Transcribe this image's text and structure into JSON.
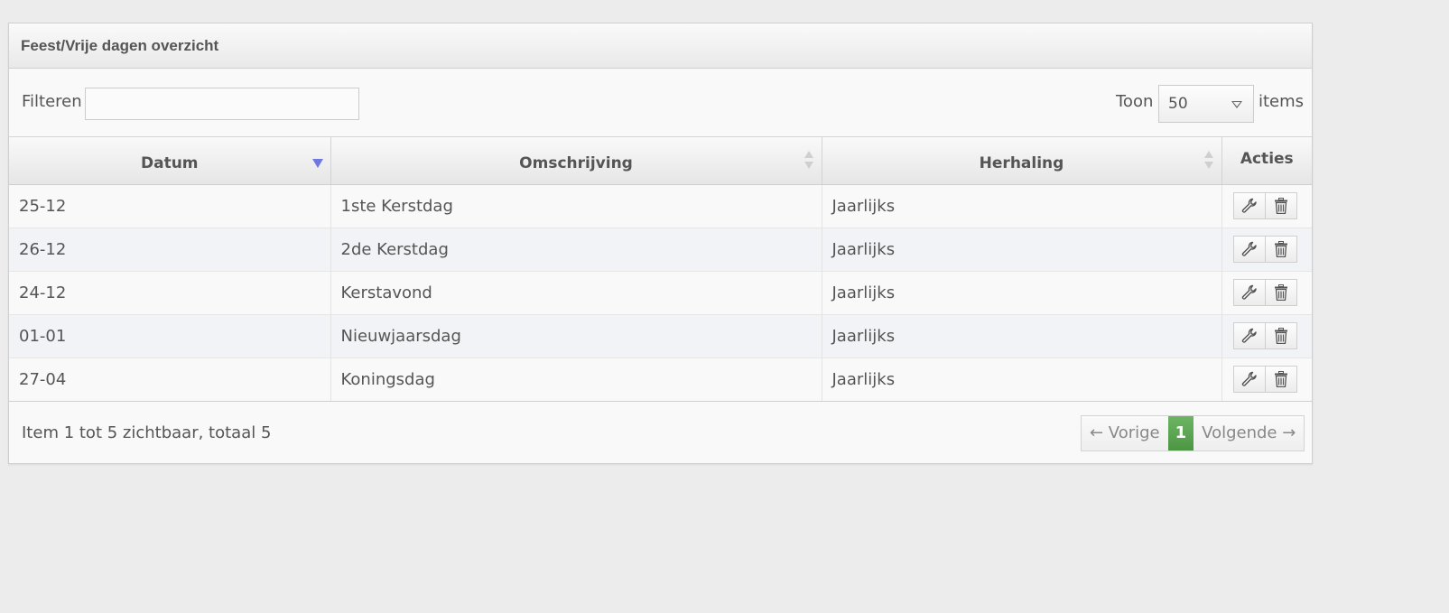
{
  "panel": {
    "title": "Feest/Vrije dagen overzicht"
  },
  "toolbar": {
    "filter_label": "Filteren",
    "filter_value": "",
    "show_label": "Toon",
    "page_size": "50",
    "items_label": "items"
  },
  "table": {
    "columns": [
      "Datum",
      "Omschrijving",
      "Herhaling",
      "Acties"
    ],
    "sort": {
      "column": "Datum",
      "direction": "descending"
    },
    "rows": [
      {
        "datum": "25-12",
        "omschrijving": "1ste Kerstdag",
        "herhaling": "Jaarlijks"
      },
      {
        "datum": "26-12",
        "omschrijving": "2de Kerstdag",
        "herhaling": "Jaarlijks"
      },
      {
        "datum": "24-12",
        "omschrijving": "Kerstavond",
        "herhaling": "Jaarlijks"
      },
      {
        "datum": "01-01",
        "omschrijving": "Nieuwjaarsdag",
        "herhaling": "Jaarlijks"
      },
      {
        "datum": "27-04",
        "omschrijving": "Koningsdag",
        "herhaling": "Jaarlijks"
      }
    ],
    "row_actions": [
      "wrench-icon",
      "trash-icon"
    ]
  },
  "footer": {
    "info": "Item 1 tot 5 zichtbaar, totaal 5",
    "prev_label": "← Vorige",
    "current_page": "1",
    "next_label": "Volgende →"
  },
  "colors": {
    "active_sort": "#7078e0",
    "current_page": "#5aa651"
  }
}
